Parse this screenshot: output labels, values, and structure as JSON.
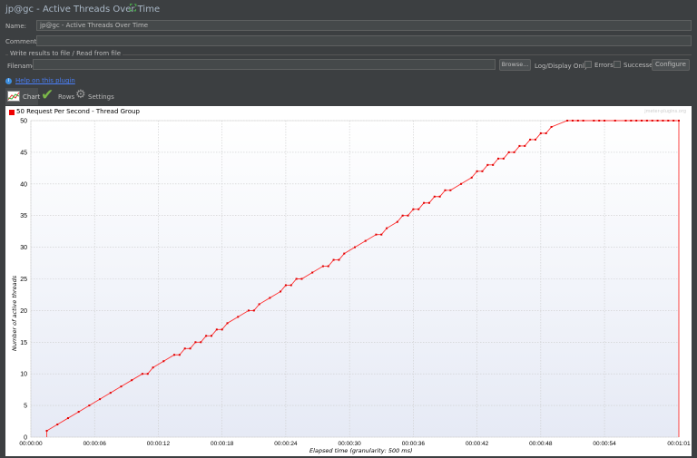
{
  "window": {
    "title": "jp@gc - Active Threads Over Time"
  },
  "form": {
    "name_label": "Name:",
    "name_value": "jp@gc - Active Threads Over Time",
    "comments_label": "Comments:",
    "comments_value": "",
    "fieldset_title": "Write results to file / Read from file",
    "filename_label": "Filename",
    "filename_value": "",
    "browse_label": "Browse...",
    "log_display_label": "Log/Display Only:",
    "errors_label": "Errors",
    "successes_label": "Successes",
    "configure_label": "Configure"
  },
  "help_link": "Help on this plugin",
  "tabs": [
    {
      "label": "Chart"
    },
    {
      "label": "Rows"
    },
    {
      "label": "Settings"
    }
  ],
  "chart_data": {
    "type": "line",
    "legend": [
      {
        "name": "50 Request Per Second - Thread Group",
        "color": "#ff0000"
      }
    ],
    "legend_placement": "top-left",
    "watermark": "jmeter-plugins.org",
    "xlabel": "Elapsed time (granularity: 500 ms)",
    "ylabel": "Number of active threads",
    "xlim": [
      0,
      61
    ],
    "ylim": [
      0,
      50
    ],
    "x_ticks": [
      0,
      6,
      12,
      18,
      24,
      30,
      36,
      42,
      48,
      54,
      61
    ],
    "x_tick_labels": [
      "00:00:00",
      "00:00:06",
      "00:00:12",
      "00:00:18",
      "00:00:24",
      "00:00:30",
      "00:00:36",
      "00:00:42",
      "00:00:48",
      "00:00:54",
      "00:01:01"
    ],
    "y_ticks": [
      0,
      5,
      10,
      15,
      20,
      25,
      30,
      35,
      40,
      45,
      50
    ],
    "y_tick_labels": [
      "0",
      "5",
      "10",
      "15",
      "20",
      "25",
      "30",
      "35",
      "40",
      "45",
      "50"
    ],
    "grid": true,
    "series": [
      {
        "name": "50 Request Per Second - Thread Group",
        "x": [
          1.5,
          2.5,
          3.5,
          4.5,
          5.5,
          6.5,
          7.5,
          8.5,
          9.5,
          10.5,
          11,
          11.5,
          12.5,
          13.5,
          14,
          14.5,
          15,
          15.5,
          16,
          16.5,
          17,
          17.5,
          18,
          18.5,
          19.5,
          20.5,
          21,
          21.5,
          22.5,
          23.5,
          24,
          24.5,
          25,
          25.5,
          26.5,
          27.5,
          28,
          28.5,
          29,
          29.5,
          30.5,
          31.5,
          32.5,
          33,
          33.5,
          34.5,
          35,
          35.5,
          36,
          36.5,
          37,
          37.5,
          38,
          38.5,
          39,
          39.5,
          40.5,
          41.5,
          42,
          42.5,
          43,
          43.5,
          44,
          44.5,
          45,
          45.5,
          46,
          46.5,
          47,
          47.5,
          48,
          48.5,
          49,
          50.5,
          51,
          51.5,
          52,
          53,
          53.5,
          54,
          55,
          56,
          56.5,
          57,
          57.5,
          58,
          58.5,
          59,
          59.5,
          60,
          60.5,
          61,
          61
        ],
        "y": [
          1,
          2,
          3,
          4,
          5,
          6,
          7,
          8,
          9,
          10,
          10,
          11,
          12,
          13,
          13,
          14,
          14,
          15,
          15,
          16,
          16,
          17,
          17,
          18,
          19,
          20,
          20,
          21,
          22,
          23,
          24,
          24,
          25,
          25,
          26,
          27,
          27,
          28,
          28,
          29,
          30,
          31,
          32,
          32,
          33,
          34,
          35,
          35,
          36,
          36,
          37,
          37,
          38,
          38,
          39,
          39,
          40,
          41,
          42,
          42,
          43,
          43,
          44,
          44,
          45,
          45,
          46,
          46,
          47,
          47,
          48,
          48,
          49,
          50,
          50,
          50,
          50,
          50,
          50,
          50,
          50,
          50,
          50,
          50,
          50,
          50,
          50,
          50,
          50,
          50,
          50,
          50,
          0
        ]
      }
    ]
  }
}
